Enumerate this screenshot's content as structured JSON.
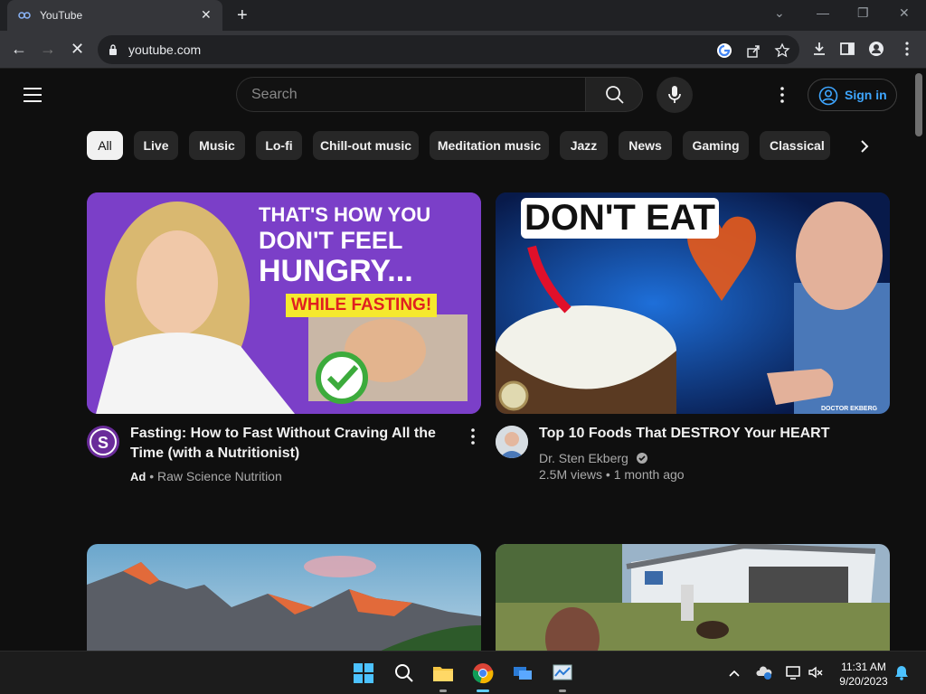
{
  "browser": {
    "tab_title": "YouTube",
    "url": "youtube.com",
    "colors": {
      "chrome": "#35363a",
      "tabbar": "#202124"
    }
  },
  "youtube": {
    "search_placeholder": "Search",
    "sign_in_label": "Sign in",
    "chips": [
      "All",
      "Live",
      "Music",
      "Lo-fi",
      "Chill-out music",
      "Meditation music",
      "Jazz",
      "News",
      "Gaming",
      "Classical"
    ],
    "videos": [
      {
        "title": "Fasting: How to Fast Without Craving All the Time (with a Nutritionist)",
        "ad_label": "Ad",
        "channel": "Raw Science Nutrition",
        "thumb_lines": [
          "THAT'S HOW YOU",
          "DON'T FEEL",
          "HUNGRY...",
          "WHILE FASTING!"
        ]
      },
      {
        "title": "Top 10 Foods That DESTROY Your HEART",
        "channel": "Dr. Sten Ekberg",
        "views": "2.5M views",
        "age": "1 month ago",
        "thumb_lines": [
          "DON'T EAT",
          "DOCTOR EKBERG"
        ]
      }
    ],
    "colors": {
      "background": "#0f0f0f",
      "link_blue": "#3ea6ff",
      "thumb1_purple": "#7b3fc8",
      "thumb1_yellow": "#f5e92e"
    }
  },
  "taskbar": {
    "time": "11:31 AM",
    "date": "9/20/2023"
  }
}
